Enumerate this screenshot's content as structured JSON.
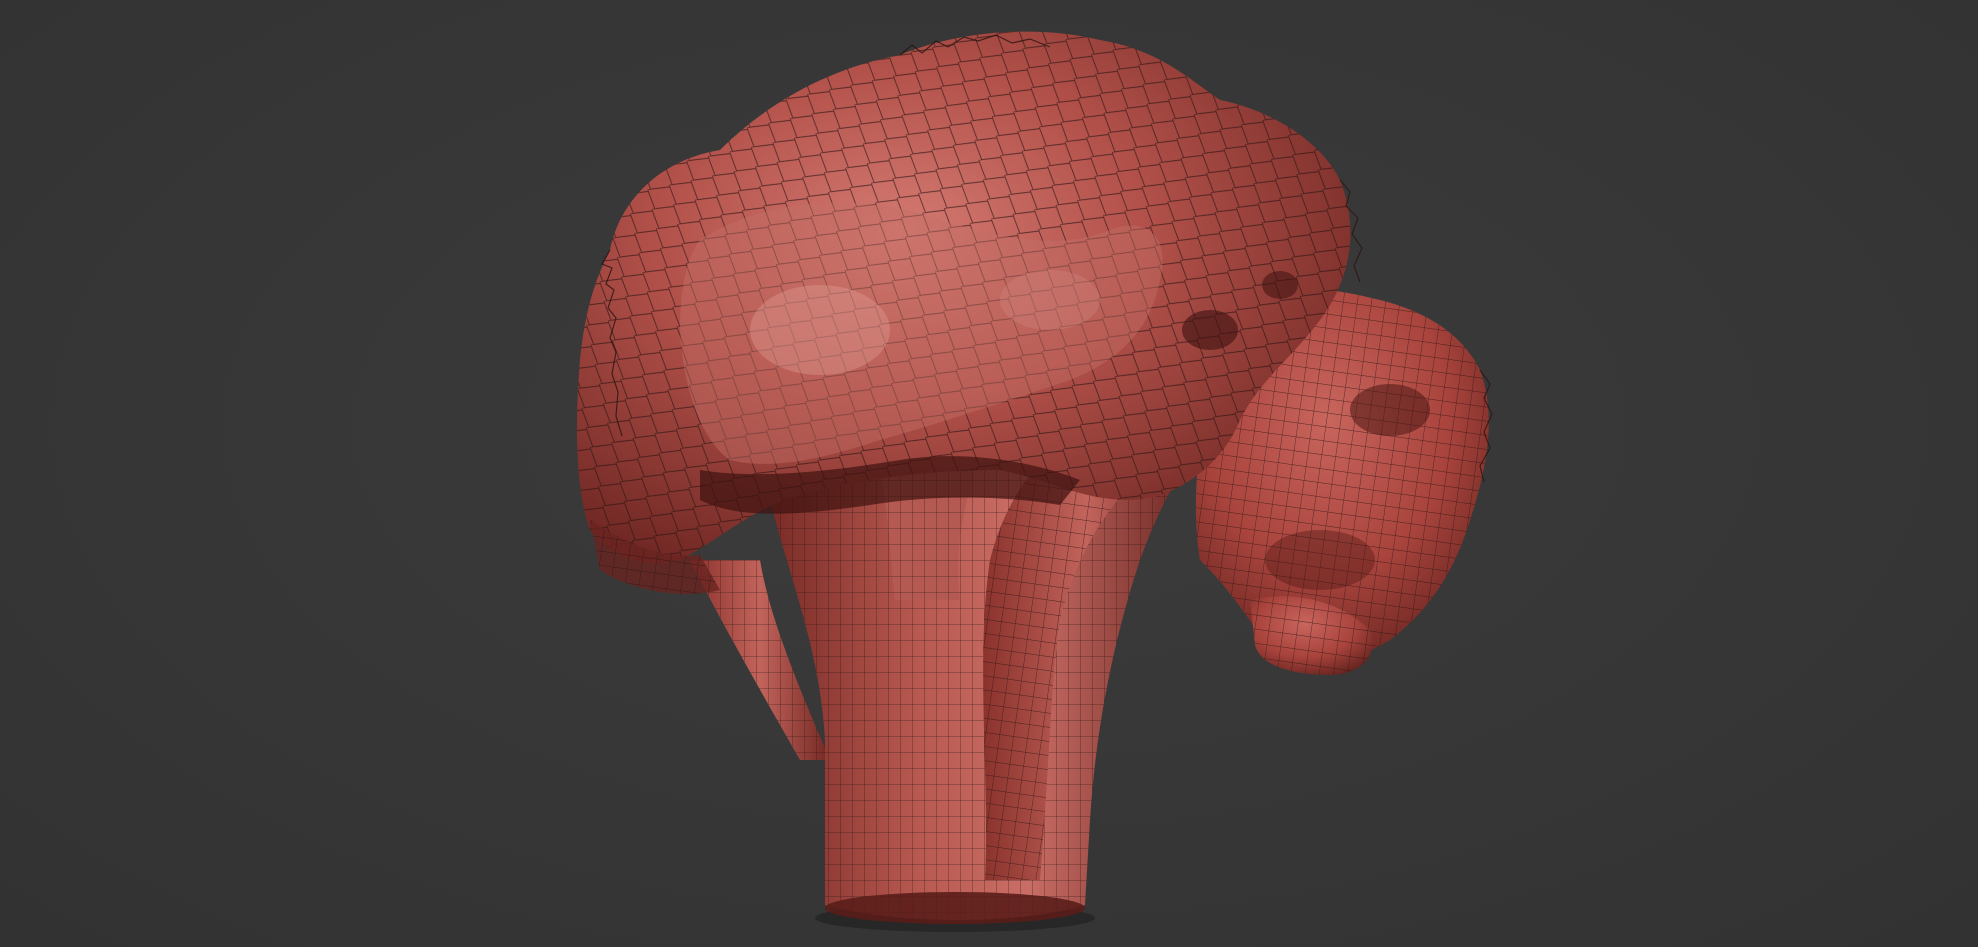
{
  "scene": {
    "subject": "broccoli-sculpt-wireframe",
    "background_color": "#383838",
    "material_color": "#b04a42",
    "material_highlight": "#d98880",
    "wire_color": "#2a1412"
  }
}
